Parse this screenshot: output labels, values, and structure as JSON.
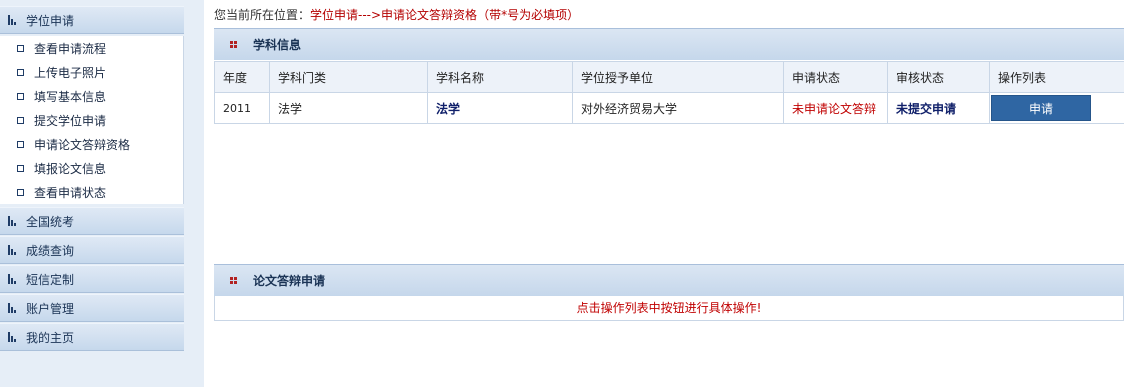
{
  "sidebar": {
    "sections": [
      {
        "label": "学位申请"
      },
      {
        "label": "全国统考"
      },
      {
        "label": "成绩查询"
      },
      {
        "label": "短信定制"
      },
      {
        "label": "账户管理"
      },
      {
        "label": "我的主页"
      }
    ],
    "submenu": [
      {
        "label": "查看申请流程"
      },
      {
        "label": "上传电子照片"
      },
      {
        "label": "填写基本信息"
      },
      {
        "label": "提交学位申请"
      },
      {
        "label": "申请论文答辩资格"
      },
      {
        "label": "填报论文信息"
      },
      {
        "label": "查看申请状态"
      }
    ]
  },
  "breadcrumb": {
    "prefix": "您当前所在位置：",
    "path": "学位申请--->申请论文答辩资格",
    "note": "（带*号为必填项）"
  },
  "subject_panel": {
    "title": "学科信息",
    "columns": [
      "年度",
      "学科门类",
      "学科名称",
      "学位授予单位",
      "申请状态",
      "审核状态",
      "操作列表"
    ],
    "row": {
      "year": "2011",
      "category": "法学",
      "name": "法学",
      "unit": "对外经济贸易大学",
      "apply_status": "未申请论文答辩",
      "review_status": "未提交申请",
      "action_label": "申请"
    }
  },
  "defense_panel": {
    "title": "论文答辩申请",
    "notice": "点击操作列表中按钮进行具体操作!"
  }
}
